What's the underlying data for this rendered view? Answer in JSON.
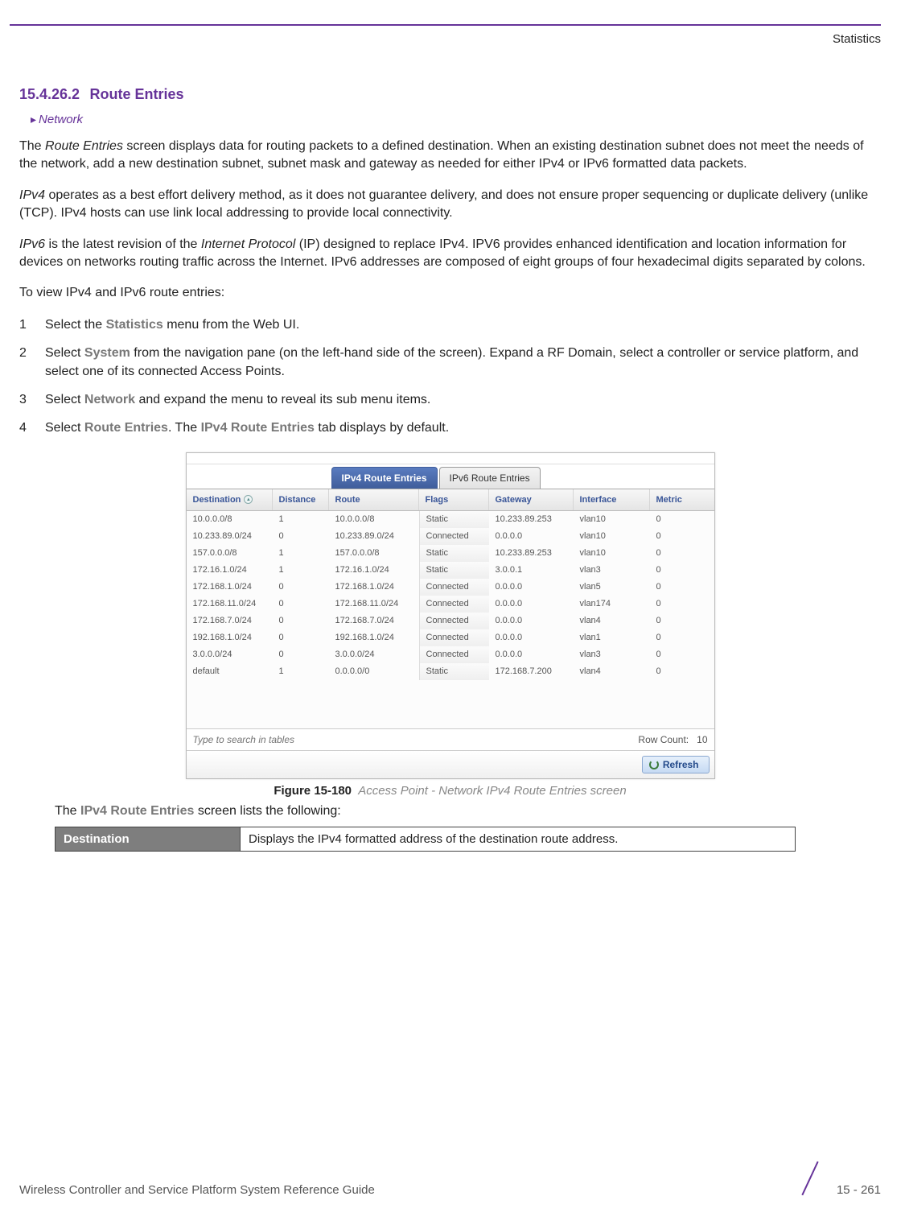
{
  "eyebrow": "Statistics",
  "section": {
    "number": "15.4.26.2",
    "title": "Route Entries"
  },
  "breadcrumb": {
    "text": "Network"
  },
  "paragraphs": {
    "p1a": "The ",
    "p1em": "Route Entries",
    "p1b": " screen displays data for routing packets to a defined destination. When an existing destination subnet does not meet the needs of the network, add a new destination subnet, subnet mask and gateway as needed for either IPv4 or IPv6 formatted data packets.",
    "p2em": "IPv4",
    "p2b": " operates as a best effort delivery method, as it does not guarantee delivery, and does not ensure proper sequencing or duplicate delivery (unlike (TCP). IPv4 hosts can use link local addressing to provide local connectivity.",
    "p3a": "IPv6",
    "p3b": " is the latest revision of the ",
    "p3em": "Internet Protocol",
    "p3c": " (IP) designed to replace IPv4. IPV6 provides enhanced identification and location information for devices on networks routing traffic across the Internet. IPv6 addresses are composed of eight groups of four hexadecimal digits separated by colons.",
    "p4": "To view IPv4 and IPv6 route entries:"
  },
  "steps": {
    "s1a": "Select the ",
    "s1kw": "Statistics",
    "s1b": " menu from the Web UI.",
    "s2a": "Select ",
    "s2kw": "System",
    "s2b": " from the navigation pane (on the left-hand side of the screen). Expand a RF Domain, select a controller or service platform, and select one of its connected Access Points.",
    "s3a": "Select ",
    "s3kw": "Network",
    "s3b": " and expand the menu to reveal its sub menu items.",
    "s4a": "Select ",
    "s4kw1": "Route Entries",
    "s4b": ". The ",
    "s4kw2": "IPv4 Route Entries",
    "s4c": " tab displays by default."
  },
  "tabs": {
    "tab1": "IPv4 Route Entries",
    "tab2": "IPv6 Route Entries"
  },
  "columns": {
    "destination": "Destination",
    "distance": "Distance",
    "route": "Route",
    "flags": "Flags",
    "gateway": "Gateway",
    "interface": "Interface",
    "metric": "Metric"
  },
  "rows": [
    {
      "destination": "10.0.0.0/8",
      "distance": "1",
      "route": "10.0.0.0/8",
      "flags": "Static",
      "gateway": "10.233.89.253",
      "interface": "vlan10",
      "metric": "0"
    },
    {
      "destination": "10.233.89.0/24",
      "distance": "0",
      "route": "10.233.89.0/24",
      "flags": "Connected",
      "gateway": "0.0.0.0",
      "interface": "vlan10",
      "metric": "0"
    },
    {
      "destination": "157.0.0.0/8",
      "distance": "1",
      "route": "157.0.0.0/8",
      "flags": "Static",
      "gateway": "10.233.89.253",
      "interface": "vlan10",
      "metric": "0"
    },
    {
      "destination": "172.16.1.0/24",
      "distance": "1",
      "route": "172.16.1.0/24",
      "flags": "Static",
      "gateway": "3.0.0.1",
      "interface": "vlan3",
      "metric": "0"
    },
    {
      "destination": "172.168.1.0/24",
      "distance": "0",
      "route": "172.168.1.0/24",
      "flags": "Connected",
      "gateway": "0.0.0.0",
      "interface": "vlan5",
      "metric": "0"
    },
    {
      "destination": "172.168.11.0/24",
      "distance": "0",
      "route": "172.168.11.0/24",
      "flags": "Connected",
      "gateway": "0.0.0.0",
      "interface": "vlan174",
      "metric": "0"
    },
    {
      "destination": "172.168.7.0/24",
      "distance": "0",
      "route": "172.168.7.0/24",
      "flags": "Connected",
      "gateway": "0.0.0.0",
      "interface": "vlan4",
      "metric": "0"
    },
    {
      "destination": "192.168.1.0/24",
      "distance": "0",
      "route": "192.168.1.0/24",
      "flags": "Connected",
      "gateway": "0.0.0.0",
      "interface": "vlan1",
      "metric": "0"
    },
    {
      "destination": "3.0.0.0/24",
      "distance": "0",
      "route": "3.0.0.0/24",
      "flags": "Connected",
      "gateway": "0.0.0.0",
      "interface": "vlan3",
      "metric": "0"
    },
    {
      "destination": "default",
      "distance": "1",
      "route": "0.0.0.0/0",
      "flags": "Static",
      "gateway": "172.168.7.200",
      "interface": "vlan4",
      "metric": "0"
    }
  ],
  "search_placeholder": "Type to search in tables",
  "row_count_label": "Row Count:",
  "row_count_value": "10",
  "refresh_label": "Refresh",
  "figure": {
    "number": "Figure 15-180",
    "title": "Access Point - Network IPv4 Route Entries screen"
  },
  "after_figure_a": "The ",
  "after_figure_kw": "IPv4 Route Entries",
  "after_figure_b": " screen lists the following:",
  "def_table": {
    "term": "Destination",
    "defn": "Displays the IPv4 formatted address of the destination route address."
  },
  "footer": {
    "guide": "Wireless Controller and Service Platform System Reference Guide",
    "page": "15 - 261"
  }
}
